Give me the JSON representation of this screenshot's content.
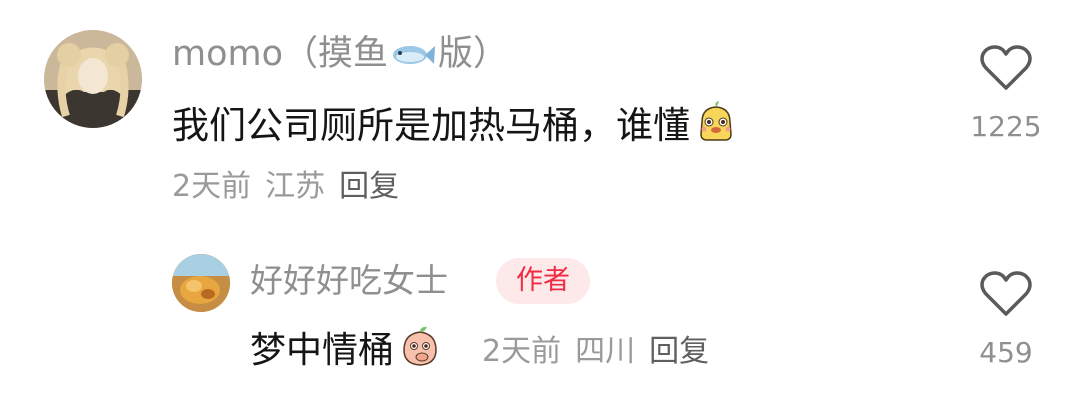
{
  "comments": [
    {
      "username_prefix": "momo（摸鱼",
      "username_icon": "fish-icon",
      "username_suffix": "版）",
      "content": "我们公司厕所是加热马桶，谁懂",
      "content_emoji": "yellow-sticker-emoji",
      "time": "2天前",
      "location": "江苏",
      "reply_label": "回复",
      "likes": "1225"
    },
    {
      "username": "好好好吃女士",
      "badge": "作者",
      "content": "梦中情桶",
      "content_emoji": "peach-sticker-emoji",
      "time": "2天前",
      "location": "四川",
      "reply_label": "回复",
      "likes": "459"
    }
  ],
  "colors": {
    "badge_bg": "#fde9ea",
    "badge_text": "#f02b42",
    "muted_text": "#8f8f8f",
    "primary_text": "#151515"
  }
}
